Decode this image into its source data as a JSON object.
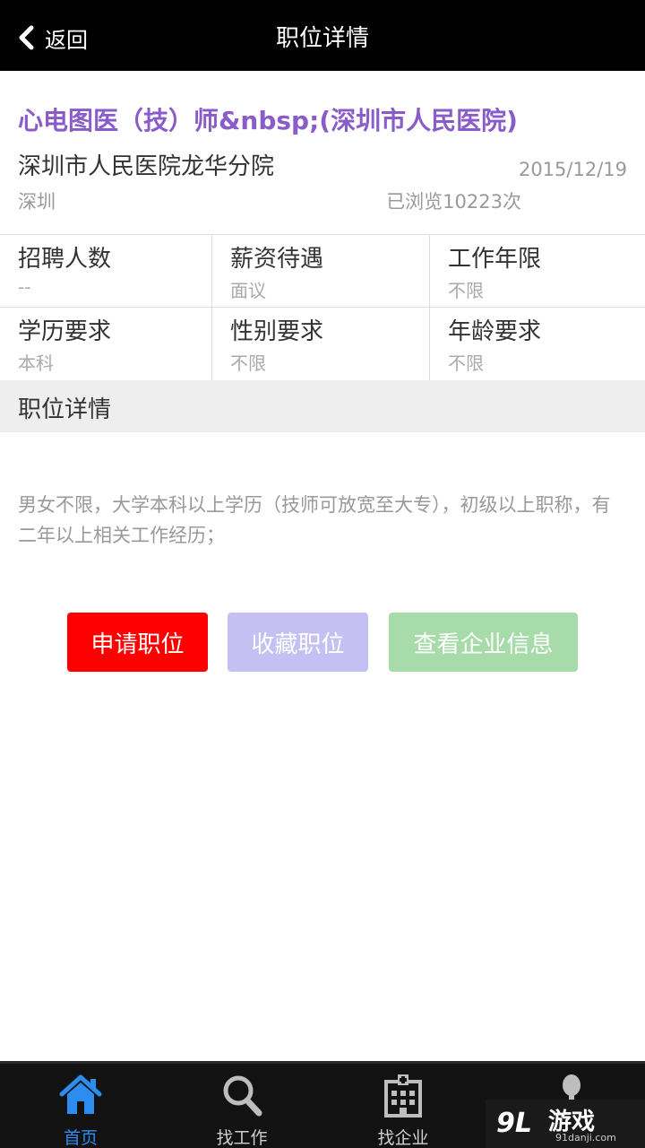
{
  "topbar": {
    "back_label": "返回",
    "title": "职位详情"
  },
  "job": {
    "title": "心电图医（技）师&nbsp;(深圳市人民医院)",
    "company": "深圳市人民医院龙华分院",
    "date": "2015/12/19",
    "city": "深圳",
    "views": "已浏览10223次"
  },
  "info": [
    {
      "label": "招聘人数",
      "value": "--"
    },
    {
      "label": "薪资待遇",
      "value": "面议"
    },
    {
      "label": "工作年限",
      "value": "不限"
    },
    {
      "label": "学历要求",
      "value": "本科"
    },
    {
      "label": "性别要求",
      "value": "不限"
    },
    {
      "label": "年龄要求",
      "value": "不限"
    }
  ],
  "section": {
    "title": "职位详情",
    "description": "男女不限，大学本科以上学历（技师可放宽至大专），初级以上职称，有二年以上相关工作经历；"
  },
  "actions": {
    "apply": "申请职位",
    "favorite": "收藏职位",
    "company": "查看企业信息"
  },
  "colors": {
    "title": "#8a5cc9",
    "apply": "#ff0000",
    "favorite": "#c5c0f3",
    "company": "#a7dba9",
    "tab_active": "#2c8cf0"
  },
  "tabs": [
    {
      "label": "首页",
      "icon": "home-icon",
      "active": true
    },
    {
      "label": "找工作",
      "icon": "search-icon",
      "active": false
    },
    {
      "label": "找企业",
      "icon": "building-icon",
      "active": false
    },
    {
      "label": "",
      "icon": "profile-icon",
      "active": false
    }
  ],
  "watermark": {
    "logo_text": "9L",
    "text": "游戏",
    "sub": "91danji.com"
  }
}
